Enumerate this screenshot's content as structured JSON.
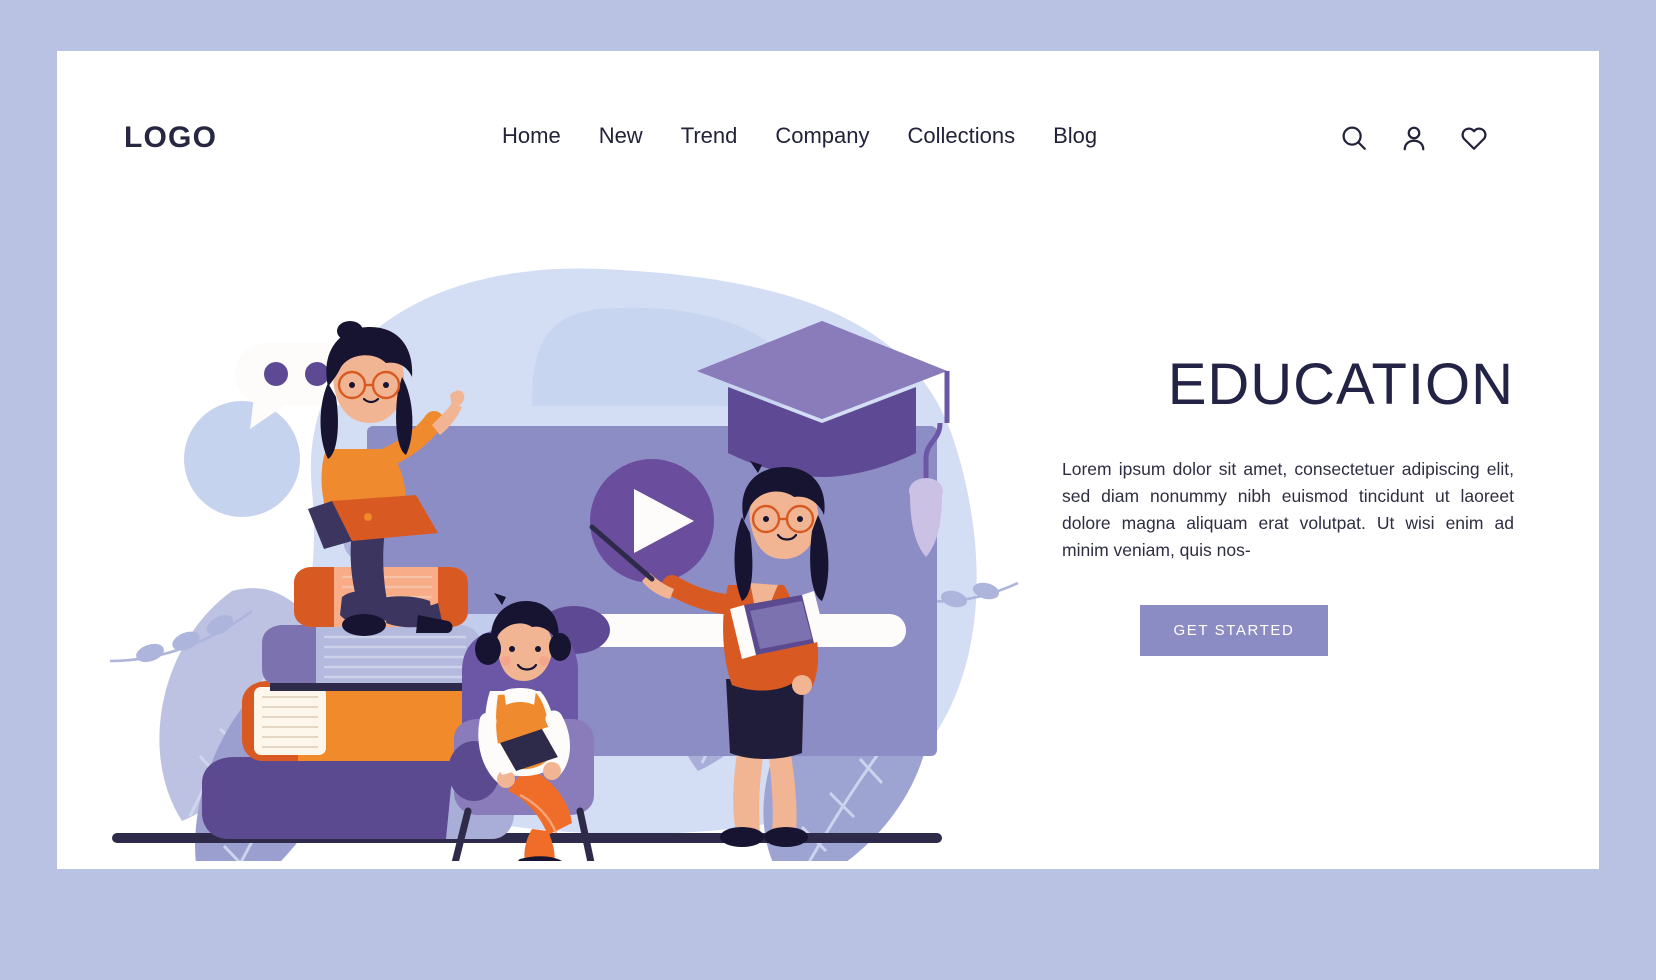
{
  "theme": {
    "outer_background": "#b9c2e2",
    "card_background": "#ffffff",
    "text_dark": "#232345",
    "accent_purple": "#6b4d9e",
    "accent_light_purple": "#8c8cc4",
    "accent_orange": "#ef7f29",
    "accent_blue_bg": "#d3ddf4"
  },
  "header": {
    "logo": "LOGO",
    "nav_items": [
      {
        "label": "Home"
      },
      {
        "label": "New"
      },
      {
        "label": "Trend"
      },
      {
        "label": "Company"
      },
      {
        "label": "Collections"
      },
      {
        "label": "Blog"
      }
    ],
    "icons": [
      {
        "name": "search-icon"
      },
      {
        "name": "user-icon"
      },
      {
        "name": "heart-icon"
      }
    ]
  },
  "hero": {
    "title": "EDUCATION",
    "paragraph": "Lorem ipsum dolor sit amet, consectetuer adipiscing elit, sed diam nonummy nibh euismod tincidunt ut laoreet dolore magna aliquam erat volutpat. Ut wisi enim ad minim veniam, quis nos-",
    "cta_label": "GET STARTED"
  },
  "illustration": {
    "name": "education-hero-illustration",
    "elements": [
      {
        "name": "chat-bubble",
        "dots": 3
      },
      {
        "name": "video-player-screen"
      },
      {
        "name": "play-button"
      },
      {
        "name": "progress-bar"
      },
      {
        "name": "graduation-cap"
      },
      {
        "name": "book-stack"
      },
      {
        "name": "woman-with-laptop"
      },
      {
        "name": "child-reading-in-armchair"
      },
      {
        "name": "teacher-with-pointer"
      },
      {
        "name": "leaf-decoration"
      }
    ]
  }
}
